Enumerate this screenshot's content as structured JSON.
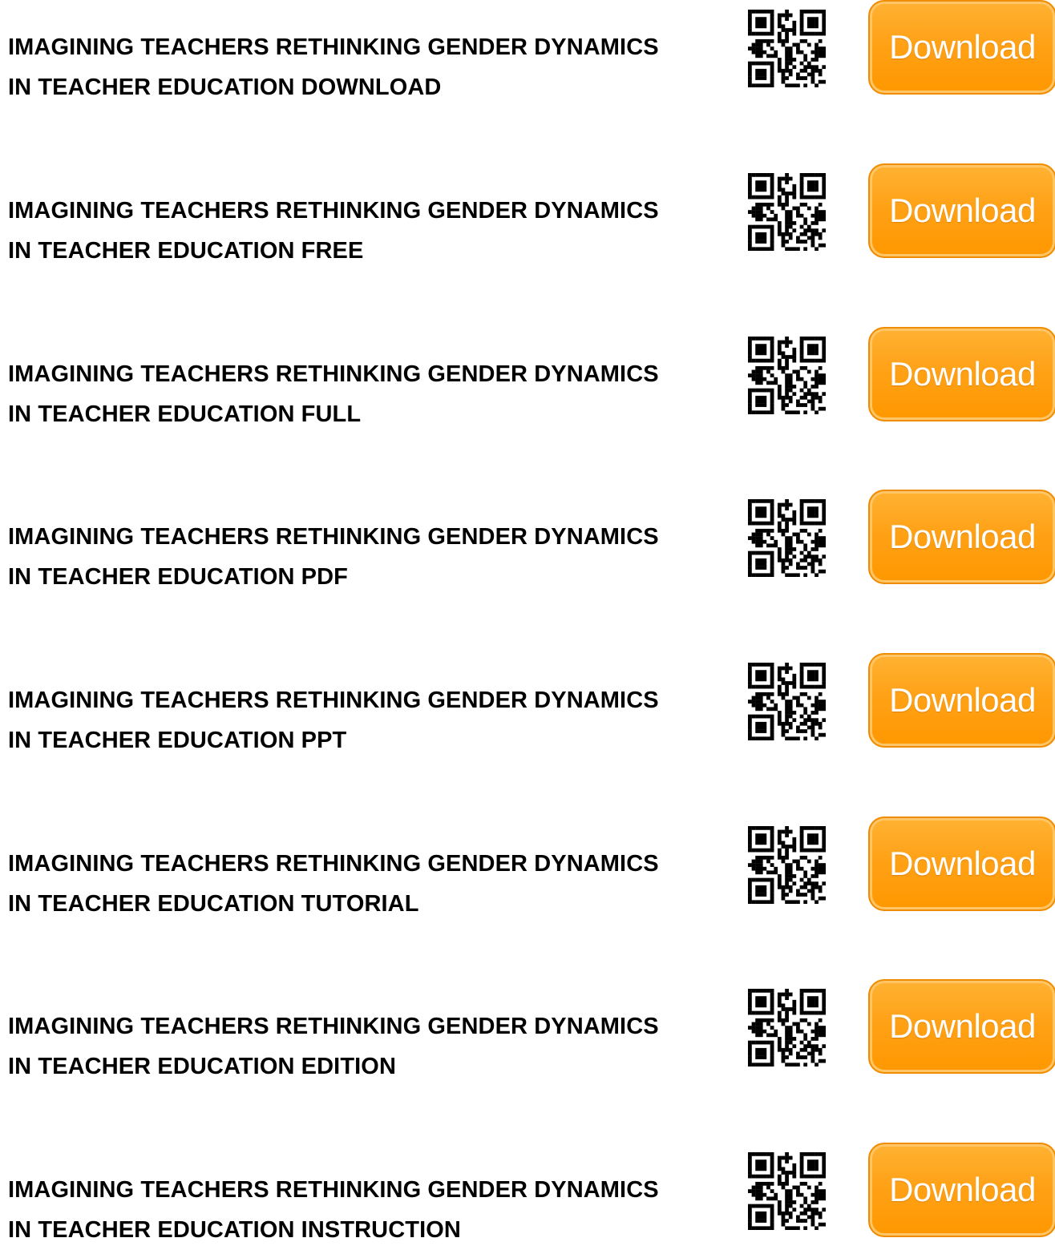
{
  "accent_color": "#ffa014",
  "items": [
    {
      "line1": "IMAGINING TEACHERS RETHINKING GENDER DYNAMICS",
      "line2": "IN TEACHER EDUCATION DOWNLOAD",
      "button_label": "Download",
      "icon": "qr-code-icon"
    },
    {
      "line1": "IMAGINING TEACHERS RETHINKING GENDER DYNAMICS",
      "line2": "IN TEACHER EDUCATION FREE",
      "button_label": "Download",
      "icon": "qr-code-icon"
    },
    {
      "line1": "IMAGINING TEACHERS RETHINKING GENDER DYNAMICS",
      "line2": "IN TEACHER EDUCATION FULL",
      "button_label": "Download",
      "icon": "qr-code-icon"
    },
    {
      "line1": "IMAGINING TEACHERS RETHINKING GENDER DYNAMICS",
      "line2": "IN TEACHER EDUCATION PDF",
      "button_label": "Download",
      "icon": "qr-code-icon"
    },
    {
      "line1": "IMAGINING TEACHERS RETHINKING GENDER DYNAMICS",
      "line2": "IN TEACHER EDUCATION PPT",
      "button_label": "Download",
      "icon": "qr-code-icon"
    },
    {
      "line1": "IMAGINING TEACHERS RETHINKING GENDER DYNAMICS",
      "line2": "IN TEACHER EDUCATION TUTORIAL",
      "button_label": "Download",
      "icon": "qr-code-icon"
    },
    {
      "line1": "IMAGINING TEACHERS RETHINKING GENDER DYNAMICS",
      "line2": "IN TEACHER EDUCATION EDITION",
      "button_label": "Download",
      "icon": "qr-code-icon"
    },
    {
      "line1": "IMAGINING TEACHERS RETHINKING GENDER DYNAMICS",
      "line2": "IN TEACHER EDUCATION INSTRUCTION",
      "button_label": "Download",
      "icon": "qr-code-icon"
    }
  ]
}
